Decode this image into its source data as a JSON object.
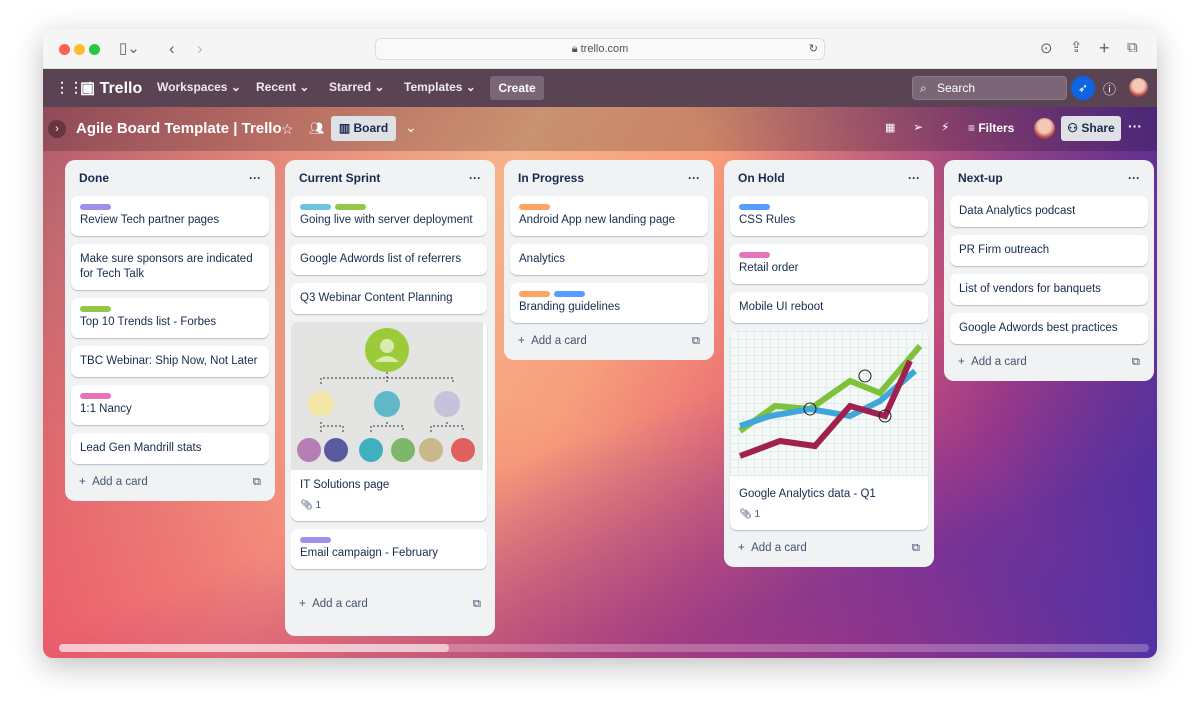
{
  "browser": {
    "url": "trello.com"
  },
  "header": {
    "app": "Trello",
    "nav": [
      "Workspaces",
      "Recent",
      "Starred",
      "Templates"
    ],
    "create": "Create",
    "search_placeholder": "Search"
  },
  "boardbar": {
    "title": "Agile Board Template | Trello",
    "view": "Board",
    "filters": "Filters",
    "share": "Share"
  },
  "add_card": "Add a card",
  "colors": {
    "purple": "#9f8fef",
    "green": "#94c748",
    "teal": "#6cc3e0",
    "orange": "#fea362",
    "blue": "#579dff",
    "pink": "#e774bb",
    "header": "#5a4454",
    "accent": "#0c66e4"
  },
  "lists": [
    {
      "title": "Done",
      "cards": [
        {
          "text": "Review Tech partner pages",
          "labels": [
            "purple"
          ]
        },
        {
          "text": "Make sure sponsors are indicated for Tech Talk",
          "labels": []
        },
        {
          "text": "Top 10 Trends list - Forbes",
          "labels": [
            "green"
          ]
        },
        {
          "text": "TBC Webinar: Ship Now, Not Later",
          "labels": []
        },
        {
          "text": "1:1 Nancy",
          "labels": [
            "pink"
          ]
        },
        {
          "text": "Lead Gen Mandrill stats",
          "labels": []
        }
      ]
    },
    {
      "title": "Current Sprint",
      "cards": [
        {
          "text": "Going live with server deployment",
          "labels": [
            "teal",
            "green"
          ]
        },
        {
          "text": "Google Adwords list of referrers",
          "labels": []
        },
        {
          "text": "Q3 Webinar Content Planning",
          "labels": []
        },
        {
          "text": "IT Solutions page",
          "labels": [],
          "cover": "org",
          "attachments": "1"
        },
        {
          "text": "Email campaign - February",
          "labels": [
            "purple"
          ]
        }
      ]
    },
    {
      "title": "In Progress",
      "cards": [
        {
          "text": "Android App new landing page",
          "labels": [
            "orange"
          ]
        },
        {
          "text": "Analytics",
          "labels": []
        },
        {
          "text": "Branding guidelines",
          "labels": [
            "orange",
            "blue"
          ]
        }
      ]
    },
    {
      "title": "On Hold",
      "cards": [
        {
          "text": "CSS Rules",
          "labels": [
            "blue"
          ]
        },
        {
          "text": "Retail order",
          "labels": [
            "pink"
          ]
        },
        {
          "text": "Mobile UI reboot",
          "labels": []
        },
        {
          "text": "Google Analytics data - Q1",
          "labels": [],
          "cover": "chart",
          "attachments": "1"
        }
      ]
    },
    {
      "title": "Next-up",
      "cards": [
        {
          "text": "Data Analytics podcast",
          "labels": []
        },
        {
          "text": "PR Firm outreach",
          "labels": []
        },
        {
          "text": "List of vendors for banquets",
          "labels": []
        },
        {
          "text": "Google Adwords best practices",
          "labels": []
        }
      ]
    }
  ]
}
